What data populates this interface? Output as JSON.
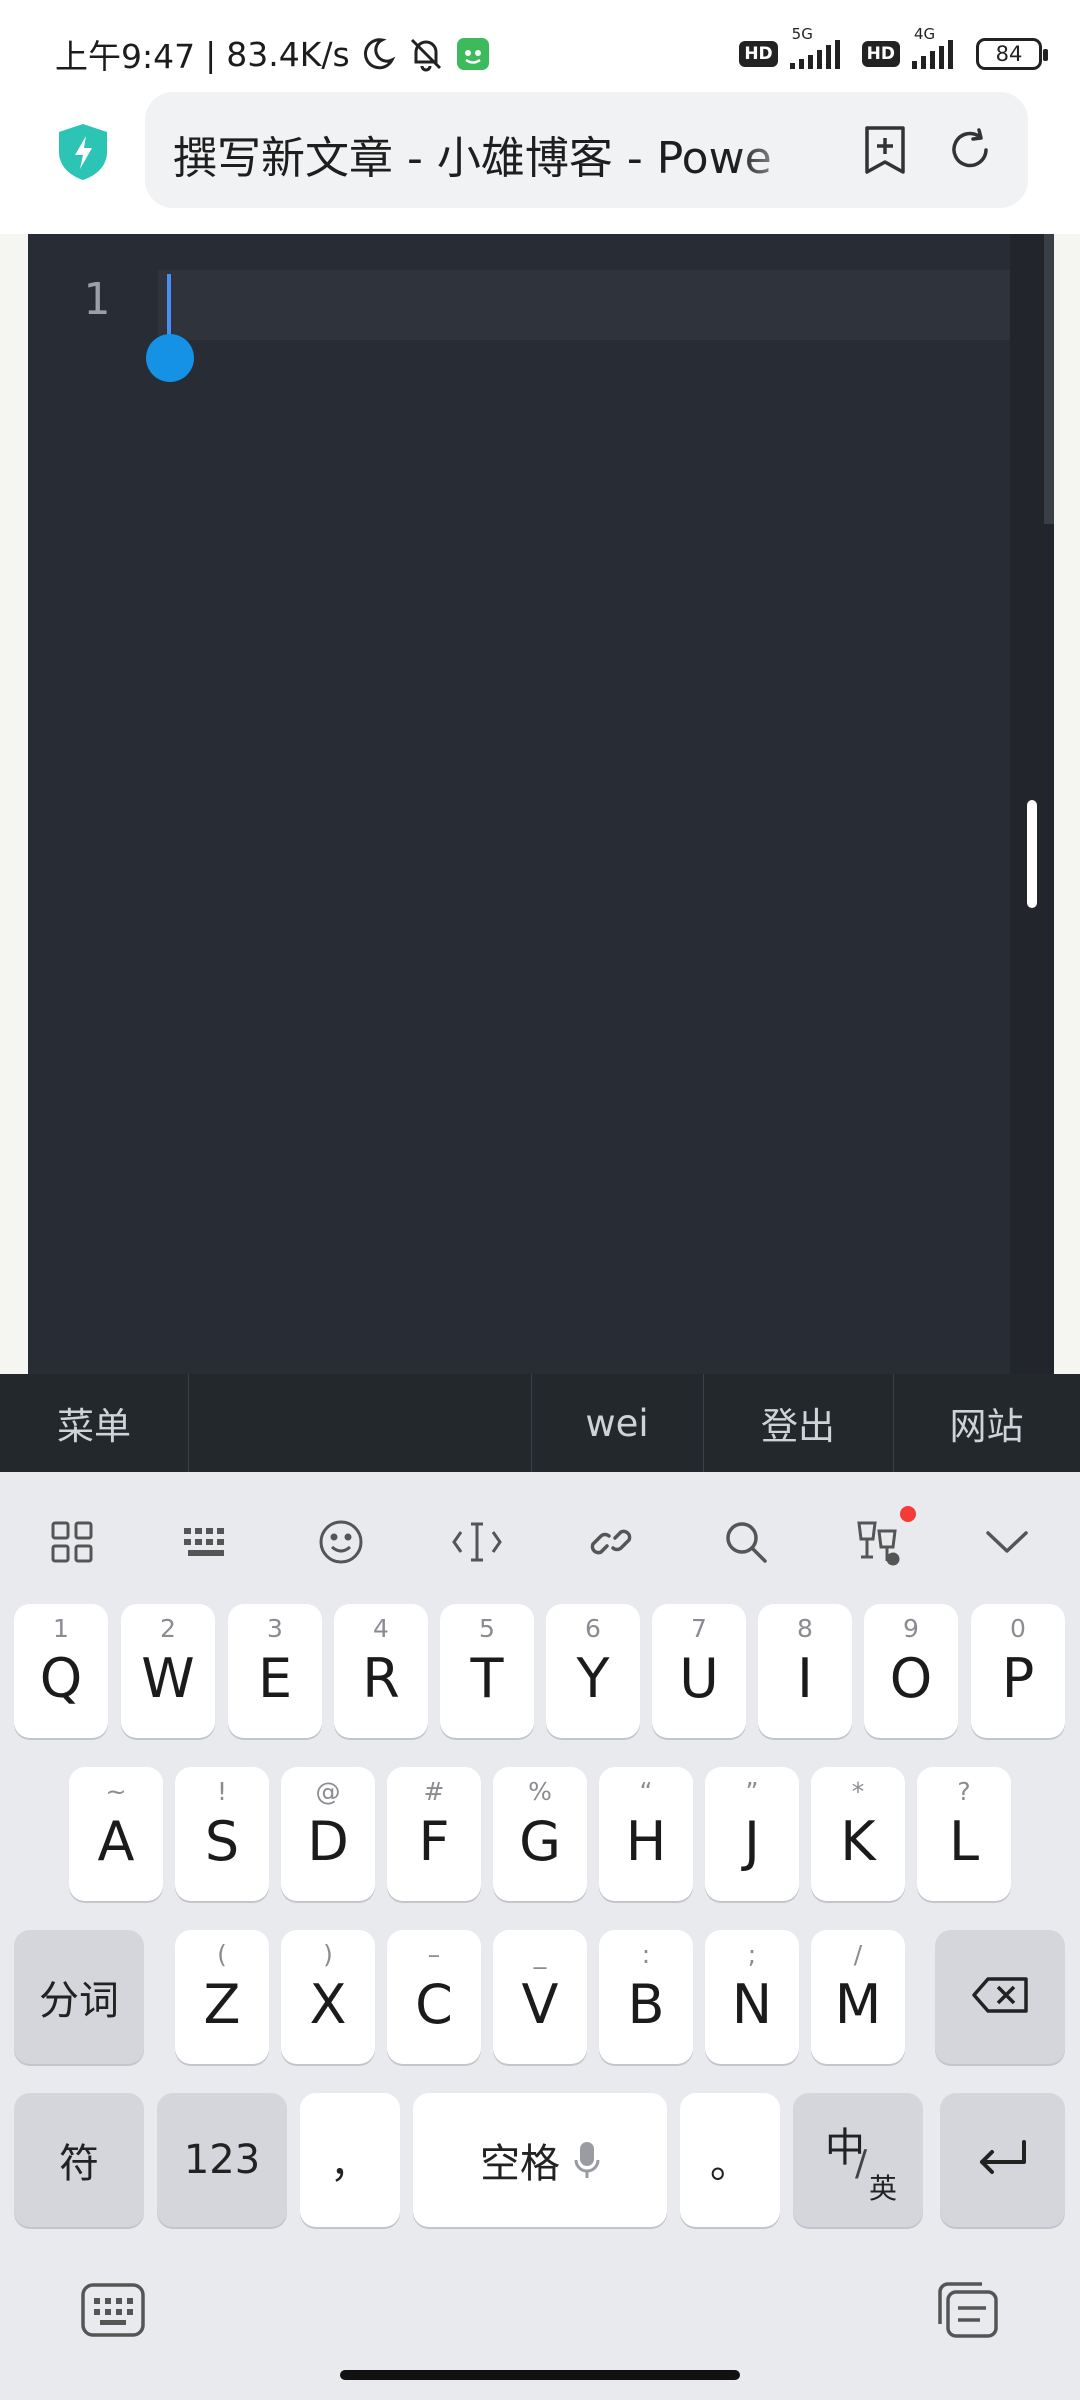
{
  "status_bar": {
    "time": "上午9:47",
    "network_speed": "83.4K/s",
    "hd_badge": "HD",
    "network_1": "5G",
    "network_2": "4G",
    "battery": "84"
  },
  "browser": {
    "page_title": "撰写新文章 - 小雄博客 - Powe"
  },
  "editor": {
    "line_number": "1"
  },
  "admin_bar": {
    "menu": "菜单",
    "user": "wei",
    "logout": "登出",
    "site": "网站"
  },
  "keyboard": {
    "row1": [
      {
        "key": "Q",
        "sub": "1"
      },
      {
        "key": "W",
        "sub": "2"
      },
      {
        "key": "E",
        "sub": "3"
      },
      {
        "key": "R",
        "sub": "4"
      },
      {
        "key": "T",
        "sub": "5"
      },
      {
        "key": "Y",
        "sub": "6"
      },
      {
        "key": "U",
        "sub": "7"
      },
      {
        "key": "I",
        "sub": "8"
      },
      {
        "key": "O",
        "sub": "9"
      },
      {
        "key": "P",
        "sub": "0"
      }
    ],
    "row2": [
      {
        "key": "A",
        "sub": "~"
      },
      {
        "key": "S",
        "sub": "!"
      },
      {
        "key": "D",
        "sub": "@"
      },
      {
        "key": "F",
        "sub": "#"
      },
      {
        "key": "G",
        "sub": "%"
      },
      {
        "key": "H",
        "sub": "“"
      },
      {
        "key": "J",
        "sub": "”"
      },
      {
        "key": "K",
        "sub": "*"
      },
      {
        "key": "L",
        "sub": "?"
      }
    ],
    "row3": [
      {
        "key": "Z",
        "sub": "("
      },
      {
        "key": "X",
        "sub": ")"
      },
      {
        "key": "C",
        "sub": "–"
      },
      {
        "key": "V",
        "sub": "_"
      },
      {
        "key": "B",
        "sub": ":"
      },
      {
        "key": "N",
        "sub": ";"
      },
      {
        "key": "M",
        "sub": "/"
      }
    ],
    "segment_key": "分词",
    "symbol_key": "符",
    "numeric_key": "123",
    "comma_key": "，",
    "space_key": "空格",
    "period_key": "。",
    "lang_main": "中",
    "lang_alt": "英"
  }
}
